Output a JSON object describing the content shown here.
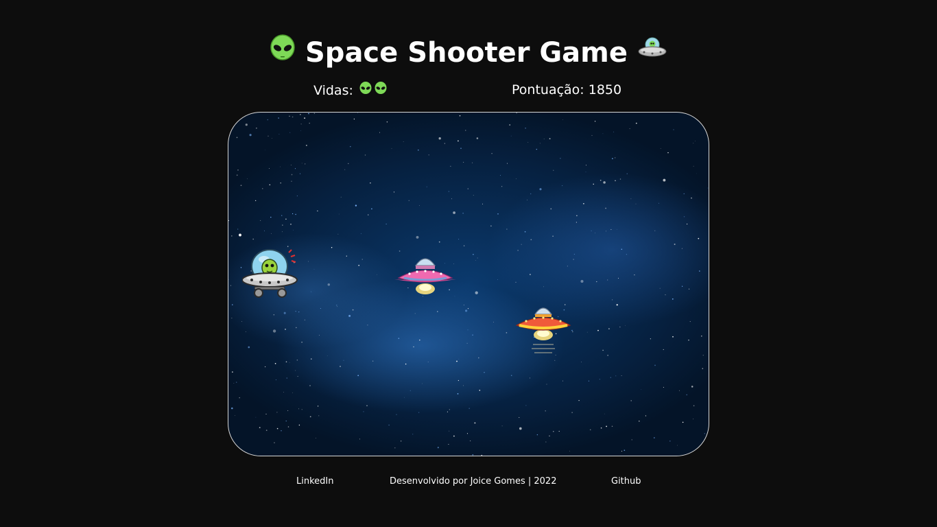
{
  "header": {
    "title": "Space Shooter Game",
    "left_icon": "alien-icon",
    "right_icon": "ufo-icon"
  },
  "hud": {
    "lives_label": "Vidas:",
    "lives_count": 2,
    "life_icon": "alien-icon",
    "score_label": "Pontuação:",
    "score_value": "1850"
  },
  "game": {
    "player": "alien-ufo-player",
    "enemies": [
      "pink-ufo-enemy",
      "red-ufo-enemy"
    ],
    "background": "starfield-nebula"
  },
  "footer": {
    "linkedin_label": "LinkedIn",
    "credit": "Desenvolvido por Joice Gomes | 2022",
    "github_label": "Github"
  },
  "colors": {
    "page_background": "#0d0d0d",
    "text": "#ffffff",
    "alien_green": "#7ed957",
    "pink_ufo": "#f06ab0",
    "red_ufo": "#f05a3a"
  }
}
